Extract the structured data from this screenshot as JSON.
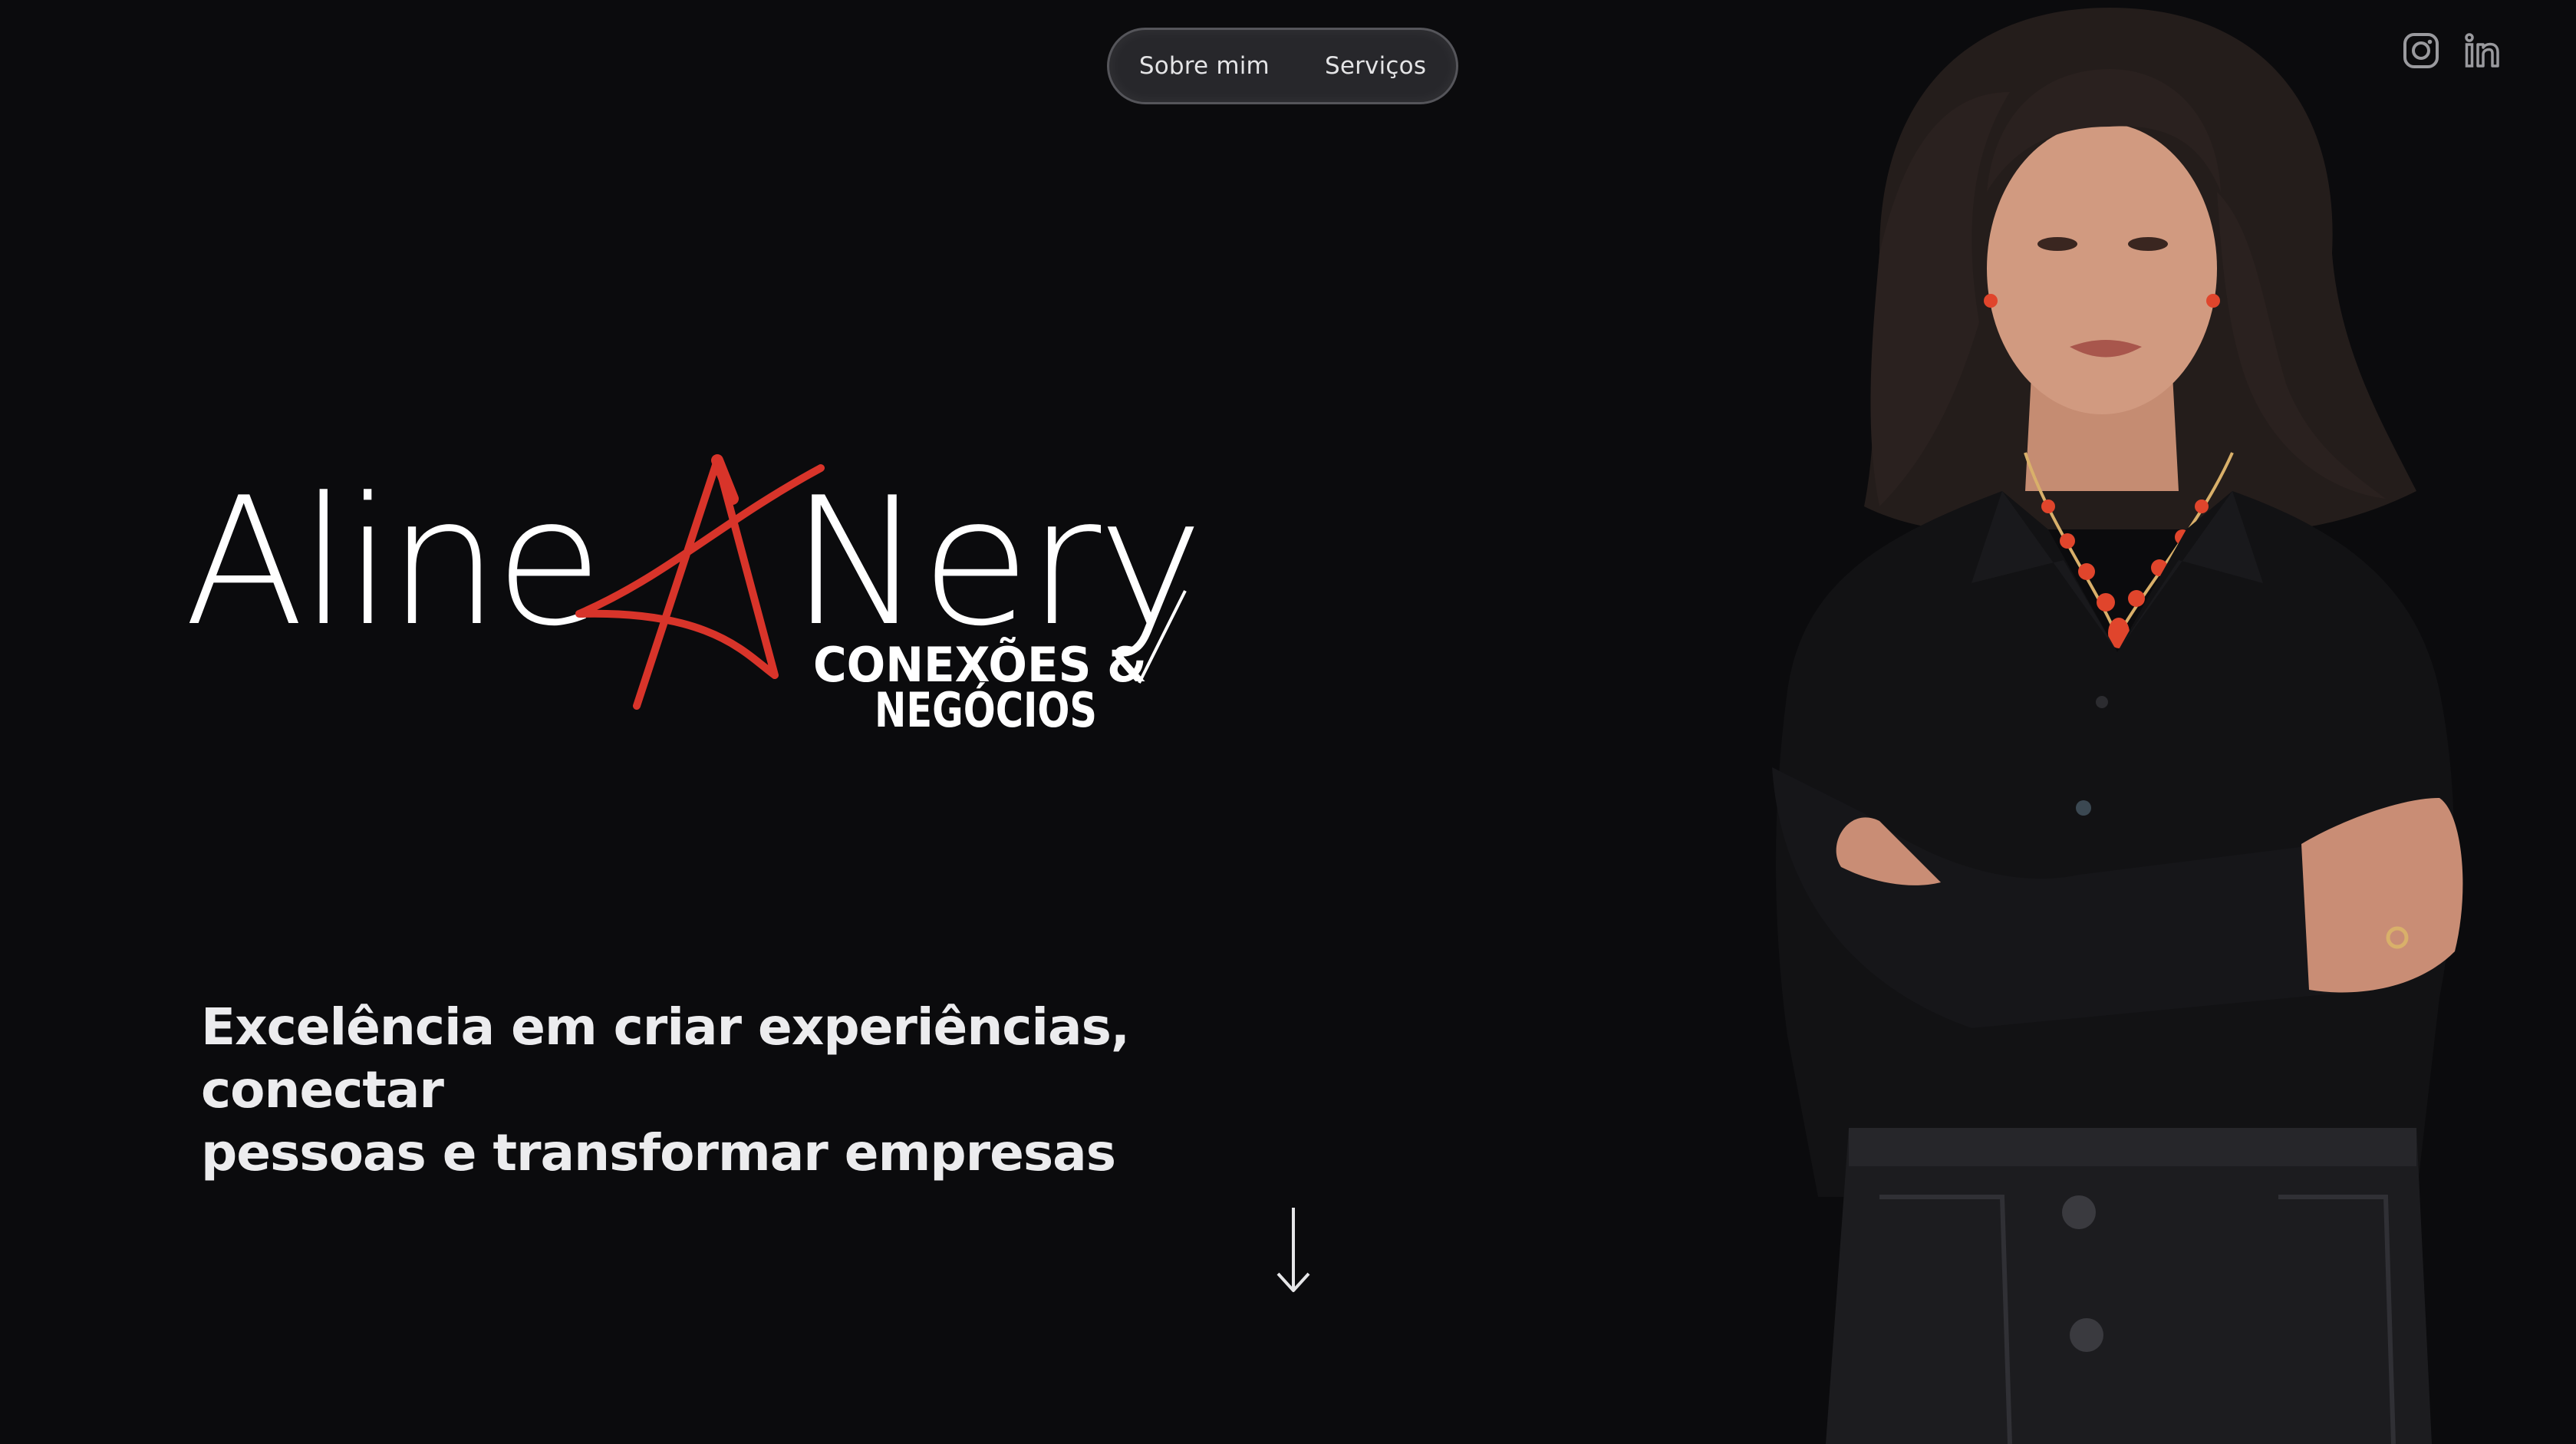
{
  "nav": {
    "items": [
      {
        "label": "Sobre mim"
      },
      {
        "label": "Serviços"
      }
    ]
  },
  "socials": [
    {
      "icon": "instagram-icon"
    },
    {
      "icon": "linkedin-icon"
    }
  ],
  "logo": {
    "first_name": "Aline",
    "last_name": "Nery",
    "subtitle_line1": "CONEXÕES &",
    "subtitle_line2": "NEGÓCIOS",
    "accent_color": "#d8342a"
  },
  "hero": {
    "tagline_line1": "Excelência em criar experiências, conectar",
    "tagline_line2": "pessoas e transformar empresas"
  },
  "scroll": {
    "icon": "arrow-down-icon"
  },
  "colors": {
    "background": "#0b0b0d",
    "text": "#ececee",
    "accent": "#d8342a"
  }
}
